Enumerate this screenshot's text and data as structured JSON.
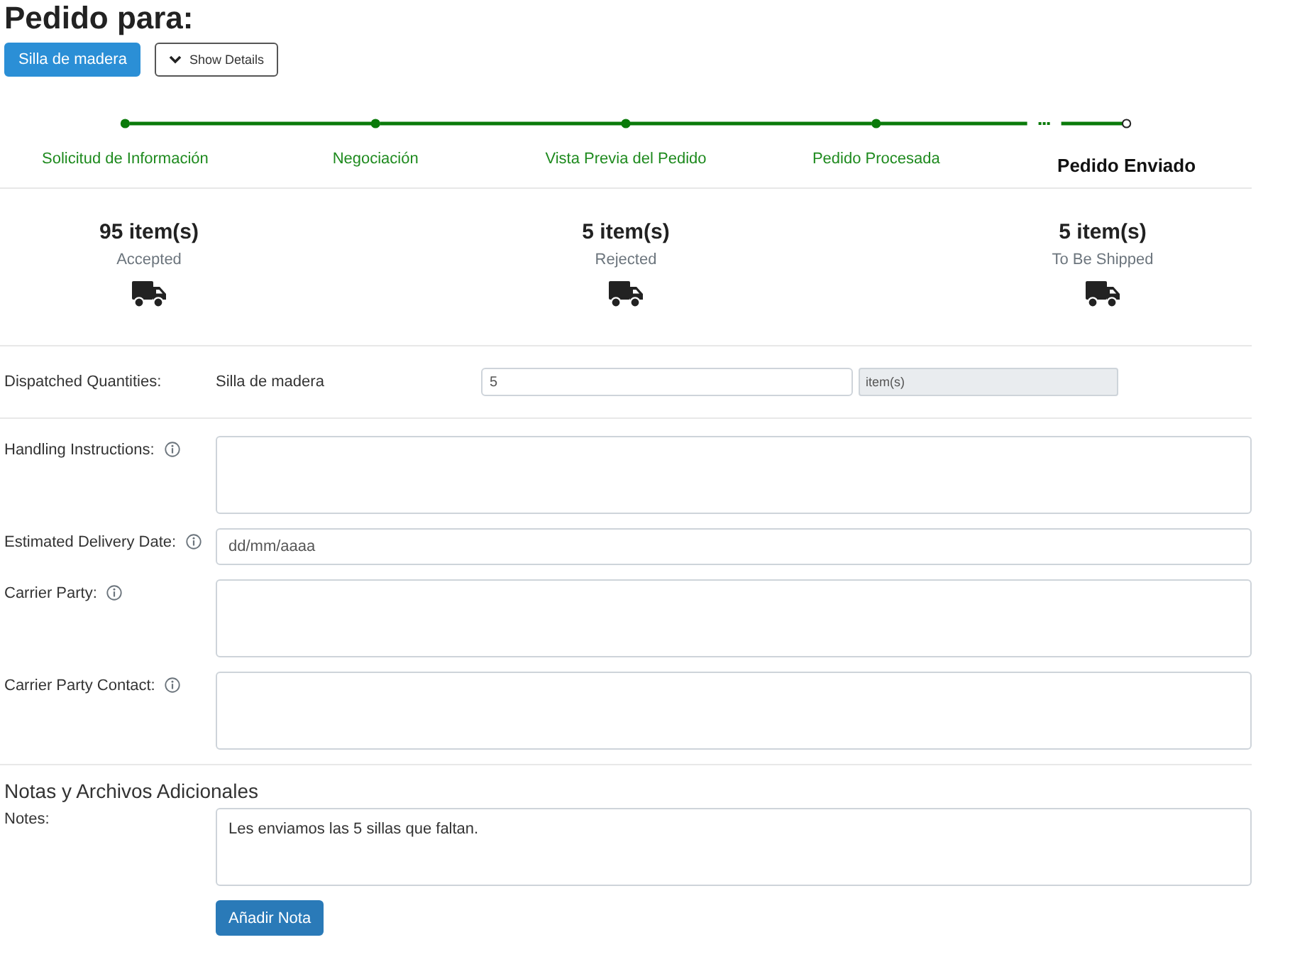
{
  "title": "Pedido para:",
  "product_button": "Silla de madera",
  "details_button": "Show Details",
  "steps": [
    {
      "label": "Solicitud de Información",
      "completed": true
    },
    {
      "label": "Negociación",
      "completed": true
    },
    {
      "label": "Vista Previa del Pedido",
      "completed": true
    },
    {
      "label": "Pedido Procesada",
      "completed": true
    },
    {
      "label": "Pedido Enviado",
      "completed": false
    }
  ],
  "stats": [
    {
      "count": "95 item(s)",
      "label": "Accepted"
    },
    {
      "count": "5 item(s)",
      "label": "Rejected"
    },
    {
      "count": "5 item(s)",
      "label": "To Be Shipped"
    }
  ],
  "dispatched": {
    "label": "Dispatched Quantities:",
    "product": "Silla de madera",
    "value": "5",
    "unit": "item(s)"
  },
  "fields": [
    {
      "label": "Handling Instructions:",
      "kind": "textarea",
      "info": true
    },
    {
      "label": "Estimated Delivery Date:",
      "kind": "date",
      "info": true,
      "placeholder": "dd/mm/aaaa"
    },
    {
      "label": "Carrier Party:",
      "kind": "textarea",
      "info": true
    },
    {
      "label": "Carrier Party Contact:",
      "kind": "textarea",
      "info": true
    }
  ],
  "notes_section": {
    "heading": "Notas y Archivos Adicionales",
    "label": "Notes:",
    "value": "Les enviamos las 5 sillas que faltan.",
    "button": "Añadir Nota"
  }
}
